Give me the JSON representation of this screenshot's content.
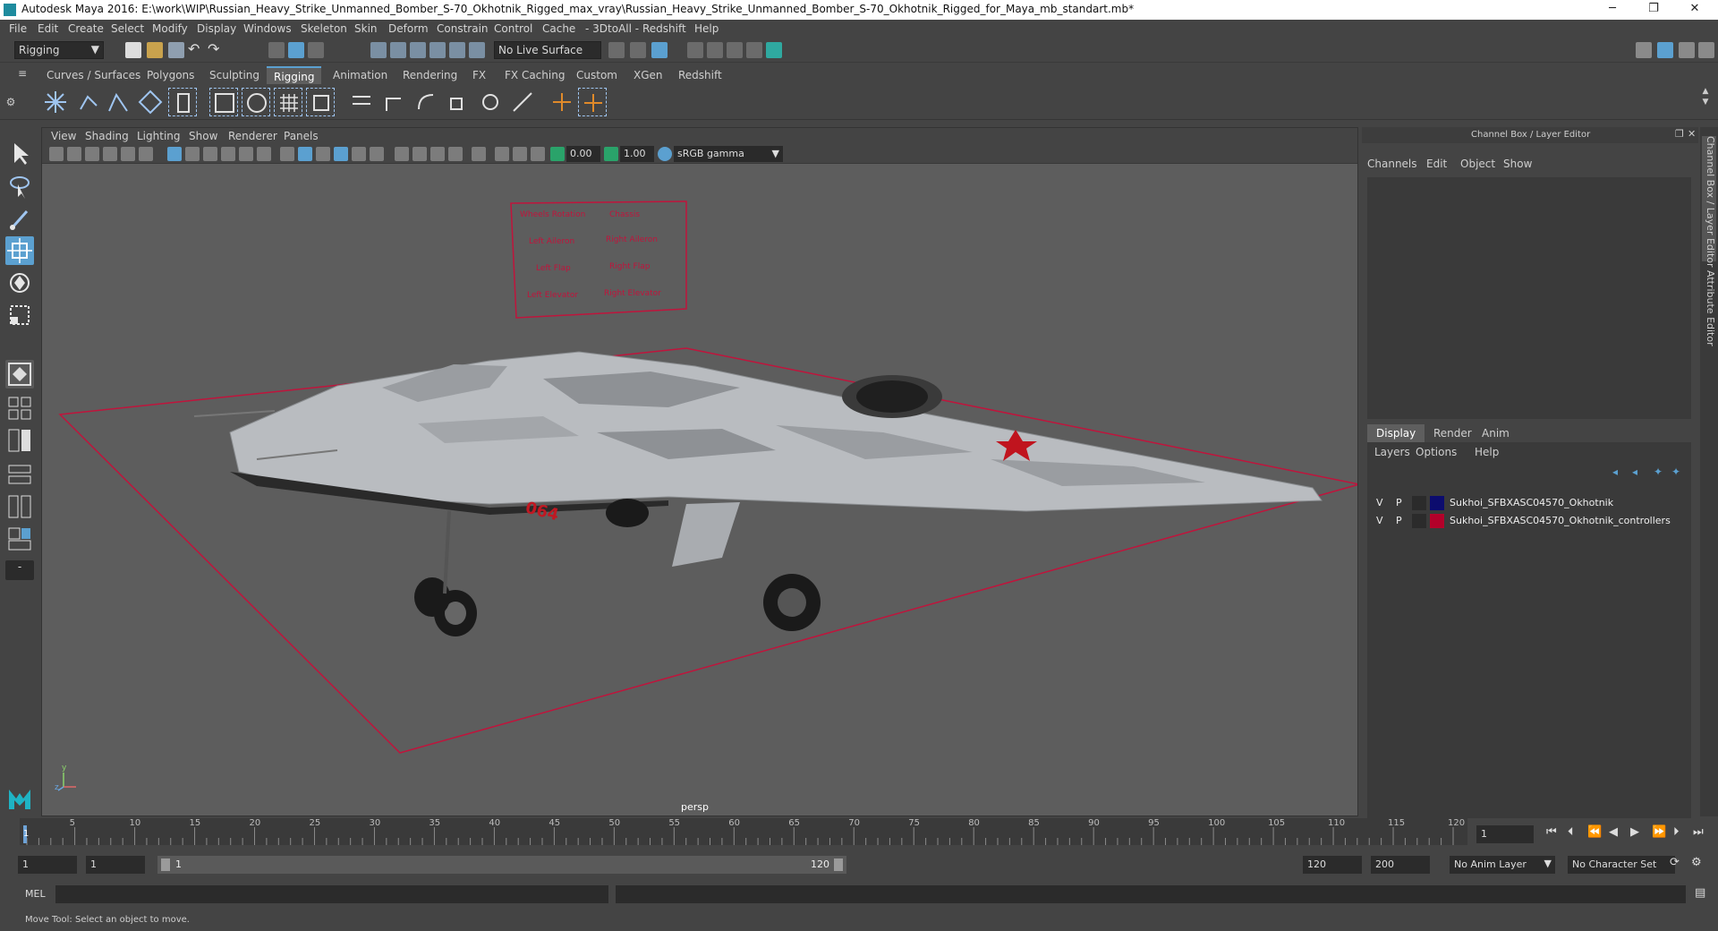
{
  "window": {
    "title": "Autodesk Maya 2016: E:\\work\\WIP\\Russian_Heavy_Strike_Unmanned_Bomber_S-70_Okhotnik_Rigged_max_vray\\Russian_Heavy_Strike_Unmanned_Bomber_S-70_Okhotnik_Rigged_for_Maya_mb_standart.mb*",
    "minimize": "─",
    "restore": "❐",
    "close": "✕"
  },
  "menubar": [
    "File",
    "Edit",
    "Create",
    "Select",
    "Modify",
    "Display",
    "Windows",
    "Skeleton",
    "Skin",
    "Deform",
    "Constrain",
    "Control",
    "Cache",
    "- 3DtoAll -",
    "Redshift",
    "Help"
  ],
  "statusline": {
    "mode": "Rigging",
    "live_surface": "No Live Surface"
  },
  "shelf_tabs": {
    "items": [
      "Curves / Surfaces",
      "Polygons",
      "Sculpting",
      "Rigging",
      "Animation",
      "Rendering",
      "FX",
      "FX Caching",
      "Custom",
      "XGen",
      "Redshift"
    ],
    "active": "Rigging"
  },
  "viewport": {
    "menus": [
      "View",
      "Shading",
      "Lighting",
      "Show",
      "Renderer",
      "Panels"
    ],
    "exposure": "0.00",
    "gamma": "1.00",
    "color_space": "sRGB gamma",
    "camera_label": "persp",
    "controller_panel": {
      "labels": [
        "Wheels Rotation",
        "Chassis",
        "Left Aileron",
        "Right Aileron",
        "Left Flap",
        "Right Flap",
        "Left Elevator",
        "Right Elevator"
      ]
    },
    "aircraft_number": "064",
    "axis_labels": {
      "y": "y",
      "z": "z"
    }
  },
  "channel_box": {
    "title": "Channel Box / Layer Editor",
    "menus": [
      "Channels",
      "Edit",
      "Object",
      "Show"
    ]
  },
  "layer_editor": {
    "tabs": [
      "Display",
      "Render",
      "Anim"
    ],
    "active_tab": "Display",
    "menus": [
      "Layers",
      "Options",
      "Help"
    ],
    "layers": [
      {
        "v": "V",
        "p": "P",
        "color": "#0c0c6e",
        "name": "Sukhoi_SFBXASC04570_Okhotnik"
      },
      {
        "v": "V",
        "p": "P",
        "color": "#b3002a",
        "name": "Sukhoi_SFBXASC04570_Okhotnik_controllers"
      }
    ]
  },
  "side_tabs": [
    "Channel Box / Layer Editor",
    "Attribute Editor"
  ],
  "timeline": {
    "ticks": [
      "5",
      "10",
      "15",
      "20",
      "25",
      "30",
      "35",
      "40",
      "45",
      "50",
      "55",
      "60",
      "65",
      "70",
      "75",
      "80",
      "85",
      "90",
      "95",
      "100",
      "105",
      "110",
      "115",
      "120"
    ],
    "start_marker": "1",
    "current_frame": "1"
  },
  "range": {
    "start": "1",
    "playback_start": "1",
    "slider_start": "1",
    "slider_end": "120",
    "playback_end": "120",
    "end": "200",
    "anim_layer": "No Anim Layer",
    "character_set": "No Character Set"
  },
  "cmdline": {
    "label": "MEL"
  },
  "helpline": {
    "text": "Move Tool: Select an object to move."
  },
  "colors": {
    "accent_blue": "#5ba0d0",
    "controller_red": "#c0143c",
    "layer1": "#0c0c6e",
    "layer2": "#b3002a"
  }
}
